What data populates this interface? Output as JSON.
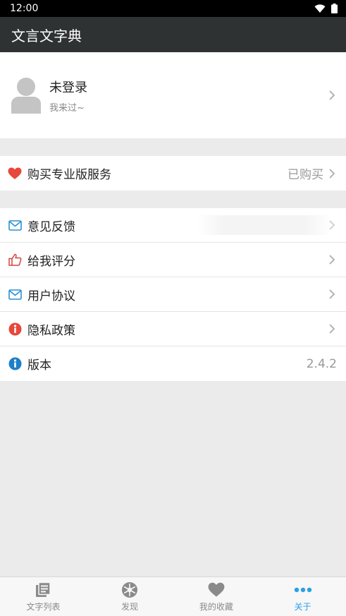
{
  "status_bar": {
    "time": "12:00"
  },
  "app_bar": {
    "title": "文言文字典"
  },
  "profile": {
    "name": "未登录",
    "subtitle": "我来过~"
  },
  "purchase": {
    "label": "购买专业版服务",
    "status": "已购买"
  },
  "menu": {
    "feedback": "意见反馈",
    "rate": "给我评分",
    "agreement": "用户协议",
    "privacy": "隐私政策",
    "version_label": "版本",
    "version_value": "2.4.2"
  },
  "tabs": [
    {
      "label": "文字列表",
      "icon": "list-icon"
    },
    {
      "label": "发现",
      "icon": "aperture-icon"
    },
    {
      "label": "我的收藏",
      "icon": "heart-icon"
    },
    {
      "label": "关于",
      "icon": "more-dots-icon"
    }
  ],
  "colors": {
    "accent": "#2aa0e6",
    "heart": "#e8473c",
    "app_bar": "#2f3233"
  }
}
